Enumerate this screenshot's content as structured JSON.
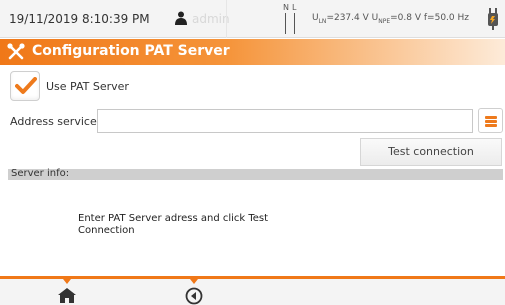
{
  "status_bar": {
    "datetime": "19/11/2019 8:10:39 PM",
    "user": "admin",
    "phase_label_n": "N",
    "phase_label_l": "L",
    "voltage": {
      "uln_label": "U",
      "uln_sub": "LN",
      "uln_value": "=237.4 V",
      "unpe_label": "U",
      "unpe_sub": "NPE",
      "unpe_value": "=0.8 V",
      "freq": "f=50.0 Hz"
    },
    "icons": [
      "user-icon",
      "plug-icon"
    ]
  },
  "title_bar": {
    "title": "Configuration PAT Server",
    "icon": "tools-icon"
  },
  "form": {
    "use_pat_server": {
      "label": "Use PAT Server",
      "checked": true
    },
    "address": {
      "label": "Address service:",
      "value": ""
    },
    "test_button": "Test connection"
  },
  "server_info": {
    "label": "Server info:",
    "message": "Enter PAT Server adress and click Test Connection"
  },
  "bottom_bar": {
    "icons": [
      "home-icon",
      "back-icon"
    ]
  },
  "colors": {
    "accent": "#f07818",
    "header_gradient_end": "#fdebd9",
    "info_bar": "#cfcfcf"
  }
}
